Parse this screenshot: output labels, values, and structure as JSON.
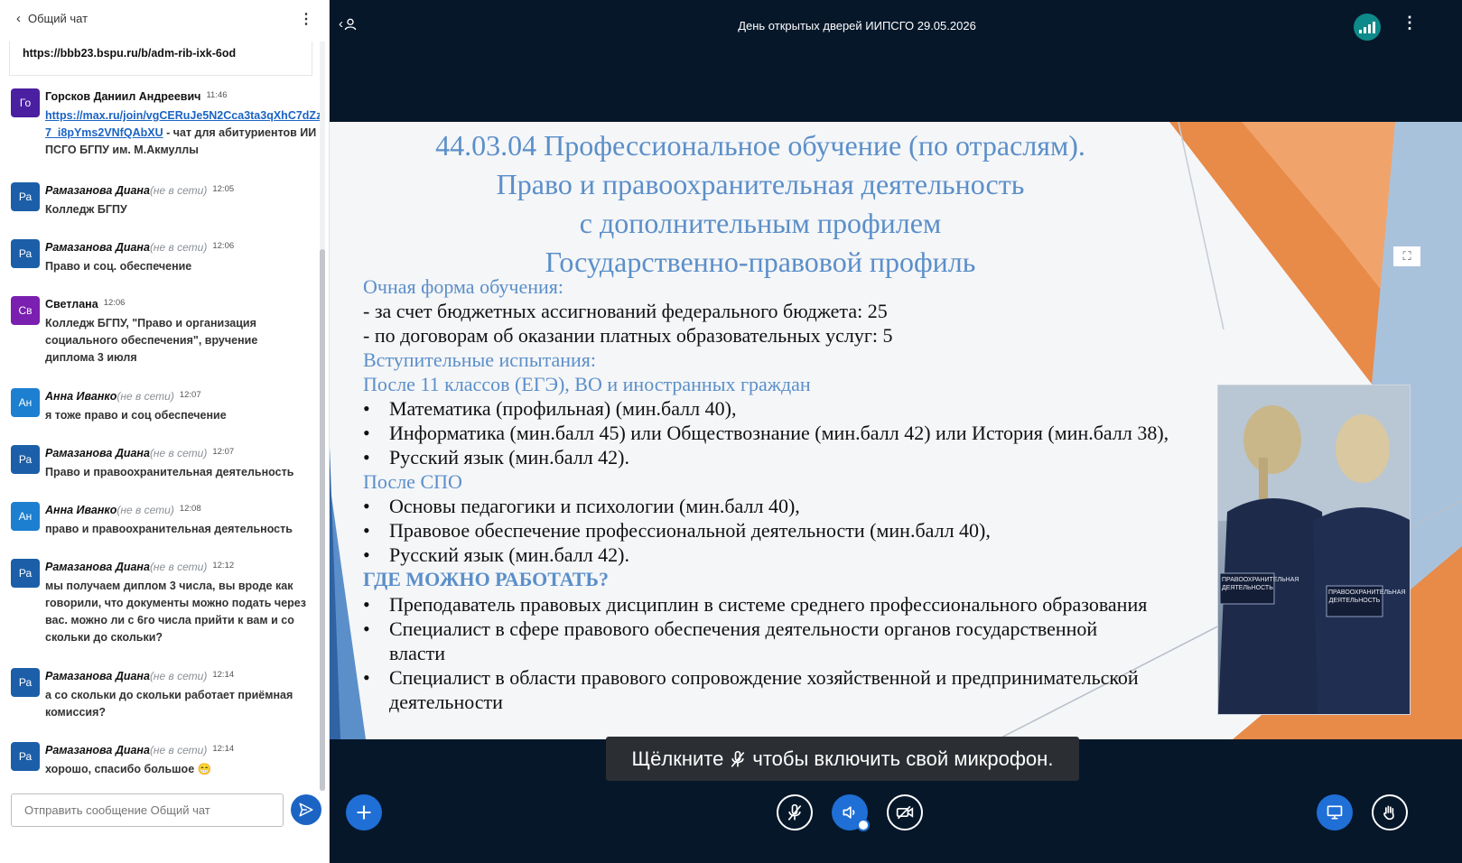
{
  "chat": {
    "header": {
      "title": "Общий чат"
    },
    "pinned_link": "https://bbb23.bspu.ru/b/adm-rib-ixk-6od",
    "messages": [
      {
        "initials": "Го",
        "avatar_color": "#4a1fa0",
        "name": "Горсков Даниил Андреевич",
        "offline": "",
        "time": "11:46",
        "link": "https://max.ru/join/vgCERuJe5N2Cca3ta3qXhC7dZz7_i8pYms2VNfQAbXU",
        "text": " - чат для абитуриентов ИИПСГО БГПУ им. М.Акмуллы"
      },
      {
        "initials": "Ра",
        "avatar_color": "#1c5fa8",
        "name": "Рамазанова Диана",
        "offline": "(не в сети)",
        "time": "12:05",
        "text": "Колледж БГПУ"
      },
      {
        "initials": "Ра",
        "avatar_color": "#1c5fa8",
        "name": "Рамазанова Диана",
        "offline": "(не в сети)",
        "time": "12:06",
        "text": "Право и соц. обеспечение"
      },
      {
        "initials": "Св",
        "avatar_color": "#7a1fb0",
        "name": "Светлана",
        "offline": "",
        "time": "12:06",
        "text": "Колледж БГПУ, \"Право и организация социального обеспечения\", вручение диплома 3 июля"
      },
      {
        "initials": "Ан",
        "avatar_color": "#1c7fd0",
        "name": "Анна Иванко",
        "offline": "(не в сети)",
        "time": "12:07",
        "text": "я тоже право и соц обеспечение"
      },
      {
        "initials": "Ра",
        "avatar_color": "#1c5fa8",
        "name": "Рамазанова Диана",
        "offline": "(не в сети)",
        "time": "12:07",
        "text": "Право и правоохранительная деятельность"
      },
      {
        "initials": "Ан",
        "avatar_color": "#1c7fd0",
        "name": "Анна Иванко",
        "offline": "(не в сети)",
        "time": "12:08",
        "text": "право и правоохранительная деятельность"
      },
      {
        "initials": "Ра",
        "avatar_color": "#1c5fa8",
        "name": "Рамазанова Диана",
        "offline": "(не в сети)",
        "time": "12:12",
        "text": "мы получаем диплом 3 числа, вы вроде как говорили, что документы можно подать через вас. можно ли с 6го числа прийти к вам и со скольки до скольки?"
      },
      {
        "initials": "Ра",
        "avatar_color": "#1c5fa8",
        "name": "Рамазанова Диана",
        "offline": "(не в сети)",
        "time": "12:14",
        "text": "а со скольки до скольки работает приёмная комиссия?"
      },
      {
        "initials": "Ра",
        "avatar_color": "#1c5fa8",
        "name": "Рамазанова Диана",
        "offline": "(не в сети)",
        "time": "12:14",
        "text": "хорошо, спасибо большое 😁"
      }
    ],
    "input_placeholder": "Отправить сообщение Общий чат"
  },
  "meeting": {
    "title": "День открытых дверей ИИПСГО 29.05.2026"
  },
  "slide": {
    "title_lines": [
      "44.03.04 Профессиональное обучение (по отраслям).",
      "Право и правоохранительная деятельность",
      "с дополнительным профилем",
      "Государственно-правовой профиль"
    ],
    "form_heading": "Очная форма обучения:",
    "budget_line": "- за счет бюджетных ассигнований федерального бюджета: 25",
    "paid_line": "- по договорам об оказании платных образовательных услуг: 5",
    "exams_heading": "Вступительные испытания:",
    "after11_heading": "После 11 классов (ЕГЭ), ВО и иностранных граждан",
    "after11_items": [
      "Математика (профильная) (мин.балл 40),",
      "Информатика (мин.балл 45) или Обществознание (мин.балл 42) или История (мин.балл 38),",
      "Русский язык (мин.балл 42)."
    ],
    "afterspo_heading": "После СПО",
    "afterspo_items": [
      "Основы педагогики и психологии (мин.балл 40),",
      "Правовое обеспечение профессиональной деятельности (мин.балл 40),",
      "Русский язык (мин.балл 42)."
    ],
    "work_heading": "ГДЕ МОЖНО РАБОТАТЬ?",
    "work_items": [
      "Преподаватель правовых дисциплин в системе среднего профессионального образования",
      "Специалист в сфере правового обеспечения деятельности органов государственной власти",
      "Специалист в области правового сопровождение хозяйственной и предпринимательской деятельности"
    ],
    "photo_patch_left": "ПРАВООХРАНИТЕЛЬНАЯ ДЕЯТЕЛЬНОСТЬ",
    "photo_patch_right": "ПРАВООХРАНИТЕЛЬНАЯ ДЕЯТЕЛЬНОСТЬ"
  },
  "tooltip": {
    "before": "Щёлкните",
    "after": "чтобы включить свой микрофон."
  },
  "icons": {
    "back": "chevron-left-icon",
    "menu": "kebab-icon",
    "users": "user-icon",
    "connection": "signal-bars-icon",
    "send": "send-icon",
    "plus": "plus-icon",
    "mic": "mic-off-icon",
    "audio": "speaker-icon",
    "camera": "camera-off-icon",
    "screen": "screen-share-icon",
    "hand": "raise-hand-icon"
  },
  "colors": {
    "accent": "#1f6fd6",
    "dark_bg": "#06172a",
    "slide_heading": "#5b8fc9"
  }
}
